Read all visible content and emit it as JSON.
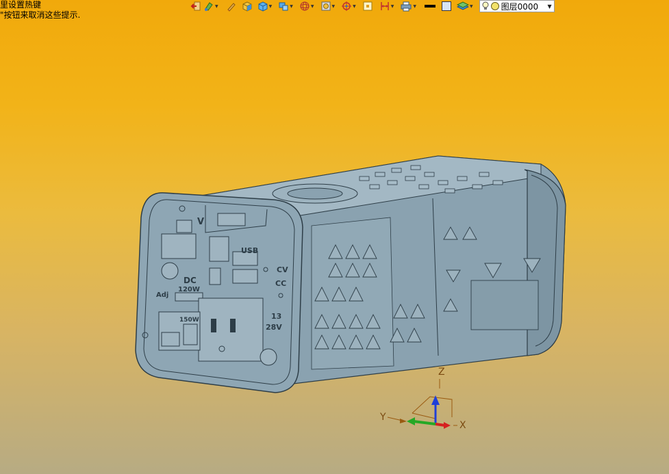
{
  "status_hint": {
    "line1": "里设置热键",
    "line2": "\"按钮来取消这些提示."
  },
  "toolbar": {
    "buttons": [
      {
        "icon": "exit-icon",
        "dropdown": false
      },
      {
        "icon": "paint-icon",
        "dropdown": true
      },
      {
        "icon": "pencil-icon",
        "dropdown": false
      },
      {
        "icon": "solid-cube-icon",
        "dropdown": false
      },
      {
        "icon": "shaded-cube-icon",
        "dropdown": true
      },
      {
        "icon": "view-cube-icon",
        "dropdown": true
      },
      {
        "icon": "wireframe-sphere-icon",
        "dropdown": true
      },
      {
        "icon": "render-icon",
        "dropdown": true
      },
      {
        "icon": "snap-target-icon",
        "dropdown": true
      },
      {
        "icon": "frame-icon",
        "dropdown": false
      },
      {
        "icon": "measure-icon",
        "dropdown": true
      },
      {
        "icon": "printer-icon",
        "dropdown": true
      },
      {
        "icon": "line-color-icon",
        "dropdown": false
      },
      {
        "icon": "fill-color-icon",
        "dropdown": false
      },
      {
        "icon": "layers-icon",
        "dropdown": true
      }
    ],
    "layer_select": {
      "value": "图层0000",
      "icons": [
        "bulb-icon",
        "sphere-icon"
      ]
    }
  },
  "model_labels": {
    "v": "V",
    "usb": "USB",
    "dc": "DC",
    "watt_dc": "120W",
    "adj": "Adj",
    "watt_ac": "150W",
    "cv": "CV",
    "cc": "CC",
    "v13": "13",
    "v28": "28V"
  },
  "axis": {
    "x": "X",
    "y": "Y",
    "z": "Z"
  },
  "colors": {
    "bg_top": "#f1a90b",
    "bg_bottom": "#b7ab83",
    "model": "#8aa2b0",
    "model_dark": "#2d3d47",
    "axis_x": "#d62020",
    "axis_y": "#25a825",
    "axis_z": "#1f3fd8"
  }
}
